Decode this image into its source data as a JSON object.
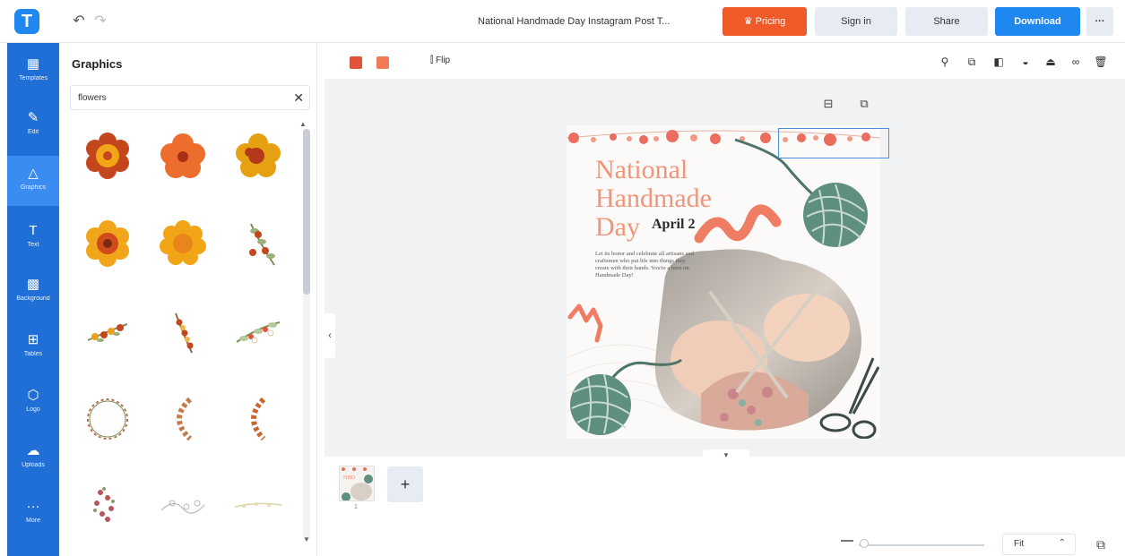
{
  "app": {
    "logo_letter": "T"
  },
  "topbar": {
    "title": "National Handmade Day Instagram Post T...",
    "pricing_label": "Pricing",
    "signin_label": "Sign in",
    "share_label": "Share",
    "download_label": "Download",
    "more_label": "···"
  },
  "nav": {
    "items": [
      {
        "icon": "templates-icon",
        "label": "Templates"
      },
      {
        "icon": "edit-icon",
        "label": "Edit"
      },
      {
        "icon": "graphics-icon",
        "label": "Graphics"
      },
      {
        "icon": "text-icon",
        "label": "Text"
      },
      {
        "icon": "background-icon",
        "label": "Background"
      },
      {
        "icon": "tables-icon",
        "label": "Tables"
      },
      {
        "icon": "logo-icon",
        "label": "Logo"
      },
      {
        "icon": "uploads-icon",
        "label": "Uploads"
      },
      {
        "icon": "more-icon",
        "label": "More"
      }
    ],
    "active_index": 2
  },
  "panel": {
    "title": "Graphics",
    "search_value": "flowers",
    "items": [
      "orange-flower-1",
      "orange-flower-2",
      "orange-flower-3",
      "orange-flower-4",
      "orange-flower-5",
      "floral-sprig-1",
      "floral-branch-1",
      "floral-branch-2",
      "floral-branch-3",
      "floral-wreath",
      "floral-crescent-1",
      "floral-crescent-2",
      "floral-cluster",
      "floral-line-1",
      "floral-line-2"
    ]
  },
  "toolbar": {
    "swatch_colors": [
      "#e0553a",
      "#f07b55"
    ],
    "flip_label": "Flip"
  },
  "design": {
    "title": "National\nHandmade\nDay",
    "date": "April 2",
    "body": "Let its honor and celebrate all artisans and craftsmen who put life into things they create with their hands. You're a hero on Handmade Day!"
  },
  "pages": {
    "current": "1"
  },
  "zoom": {
    "value": "Fit",
    "fraction": 0.05
  },
  "colors": {
    "brand": "#1f87f0",
    "pricing": "#f05a28",
    "accent_title": "#f0957b",
    "yarn_green": "#5e8f80"
  }
}
